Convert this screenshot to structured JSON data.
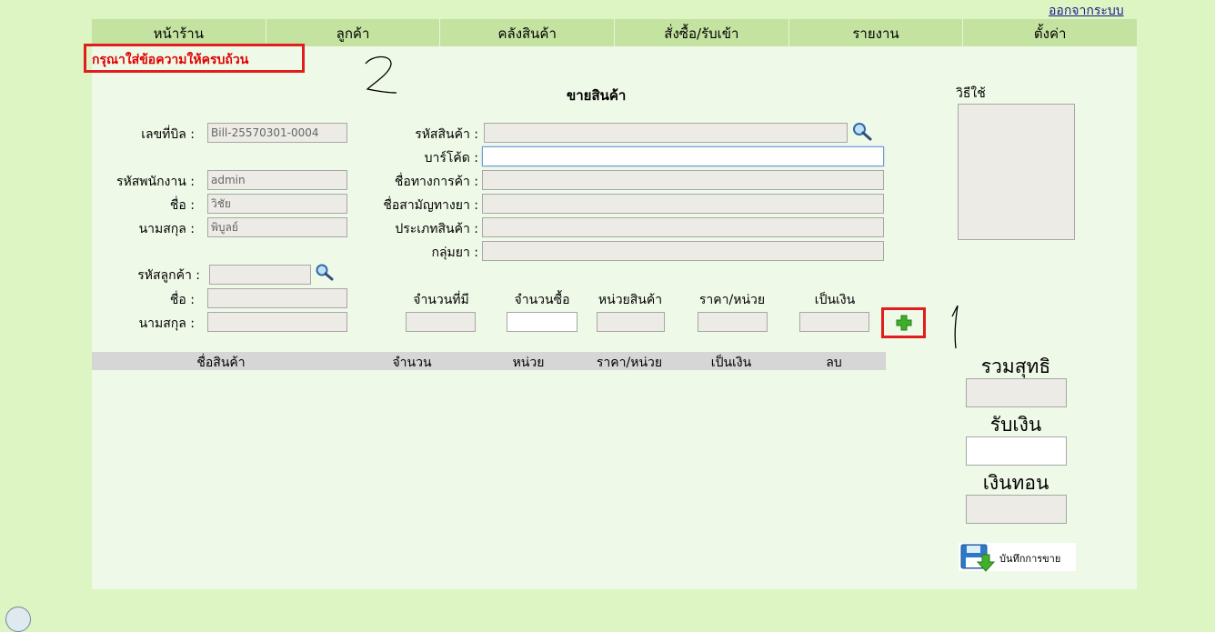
{
  "header": {
    "logout_label": "ออกจากระบบ"
  },
  "nav": {
    "items": [
      "หน้าร้าน",
      "ลูกค้า",
      "คลังสินค้า",
      "สั่งซื้อ/รับเข้า",
      "รายงาน",
      "ตั้งค่า"
    ]
  },
  "alert": {
    "message": "กรุณาใส่ข้อความให้ครบถ้วน"
  },
  "annotations": {
    "mark_2": "2",
    "mark_1": "1"
  },
  "form": {
    "title": "ขายสินค้า",
    "bill": {
      "label": "เลขที่บิล :",
      "value": "Bill-25570301-0004"
    },
    "employee_id": {
      "label": "รหัสพนักงาน :",
      "value": "admin"
    },
    "first_name": {
      "label": "ชื่อ :",
      "value": "วิชัย"
    },
    "last_name": {
      "label": "นามสกุล :",
      "value": "พิบูลย์"
    },
    "customer_id": {
      "label": "รหัสลูกค้า :",
      "value": ""
    },
    "customer_first_name": {
      "label": "ชื่อ :",
      "value": ""
    },
    "customer_last_name": {
      "label": "นามสกุล :",
      "value": ""
    },
    "product_code": {
      "label": "รหัสสินค้า :",
      "value": ""
    },
    "barcode": {
      "label": "บาร์โค้ด :",
      "value": ""
    },
    "trade_name": {
      "label": "ชื่อทางการค้า :",
      "value": ""
    },
    "generic_name": {
      "label": "ชื่อสามัญทางยา :",
      "value": ""
    },
    "product_type": {
      "label": "ประเภทสินค้า :",
      "value": ""
    },
    "drug_group": {
      "label": "กลุ่มยา :",
      "value": ""
    }
  },
  "item_entry": {
    "headers": [
      "จำนวนที่มี",
      "จำนวนซื้อ",
      "หน่วยสินค้า",
      "ราคา/หน่วย",
      "เป็นเงิน"
    ]
  },
  "usage": {
    "label": "วิธีใช้"
  },
  "table": {
    "columns": [
      "ชื่อสินค้า",
      "จำนวน",
      "หน่วย",
      "ราคา/หน่วย",
      "เป็นเงิน",
      "ลบ"
    ]
  },
  "totals": {
    "net_label": "รวมสุทธิ",
    "received_label": "รับเงิน",
    "change_label": "เงินทอน"
  },
  "save": {
    "label": "บันทึกการขาย"
  },
  "colors": {
    "accent_red": "#e11d1d",
    "nav_green": "#c4e3a0",
    "page_green": "#dcf5c3"
  }
}
